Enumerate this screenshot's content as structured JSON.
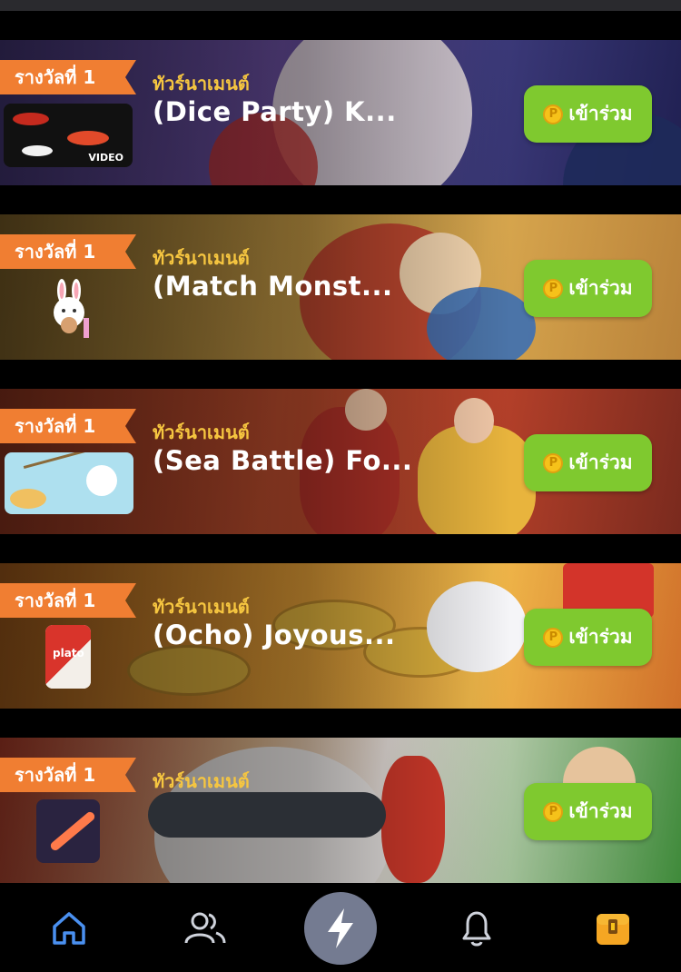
{
  "cards": [
    {
      "rank": "รางวัลที่ 1",
      "tag": "ทัวร์นาเมนต์",
      "title": "(Dice Party) K...",
      "join": "เข้าร่วม",
      "video_label": "VIDEO",
      "bg": "#3a2f6e"
    },
    {
      "rank": "รางวัลที่ 1",
      "tag": "ทัวร์นาเมนต์",
      "title": "(Match Monst...",
      "join": "เข้าร่วม",
      "bg": "#b98a3a"
    },
    {
      "rank": "รางวัลที่ 1",
      "tag": "ทัวร์นาเมนต์",
      "title": "(Sea Battle) Fo...",
      "join": "เข้าร่วม",
      "bg": "#b6472a"
    },
    {
      "rank": "รางวัลที่ 1",
      "tag": "ทัวร์นาเมนต์",
      "title": "(Ocho) Joyous...",
      "join": "เข้าร่วม",
      "thumb_text": "plato",
      "bg": "#d98a28"
    },
    {
      "rank": "รางวัลที่ 1",
      "tag": "ทัวร์นาเมนต์",
      "title": "",
      "join": "เข้าร่วม",
      "bg": "#c9372e"
    }
  ],
  "coin_symbol": "P",
  "nav": {
    "items": [
      "home-icon",
      "friends-icon",
      "lightning-icon",
      "bell-icon",
      "treasure-chest-icon"
    ],
    "active": "home-icon",
    "accent": "#4a90f0"
  },
  "colors": {
    "join_button": "#7fc92f",
    "rank_banner": "#f07e32",
    "tag_text": "#f6c640"
  }
}
